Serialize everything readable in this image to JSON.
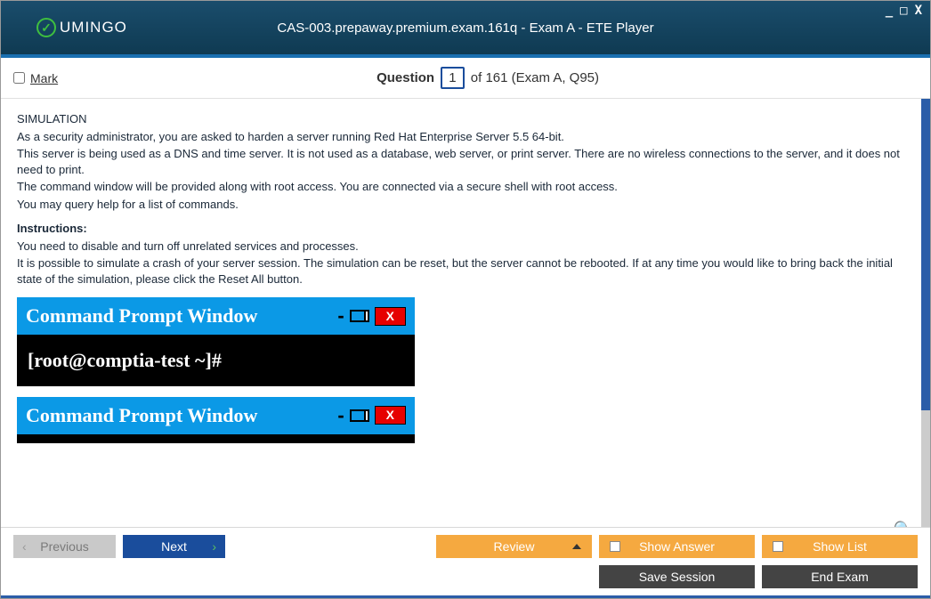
{
  "titlebar": {
    "logo_text": "UMINGO",
    "title": "CAS-003.prepaway.premium.exam.161q - Exam A - ETE Player"
  },
  "header": {
    "mark_label": "Mark",
    "question_label": "Question",
    "question_number": "1",
    "question_total": "of 161 (Exam A, Q95)"
  },
  "content": {
    "sim_label": "SIMULATION",
    "para1_l1": "As a security administrator, you are asked to harden a server running Red Hat Enterprise Server 5.5 64-bit.",
    "para1_l2": "This server is being used as a DNS and time server. It is not used as a database, web server, or print server. There are no wireless connections to the server, and it does not need to print.",
    "para1_l3": "The command window will be provided along with root access. You are connected via a secure shell with root access.",
    "para1_l4": "You may query help for a list of commands.",
    "instr_label": "Instructions:",
    "para2_l1": "You need to disable and turn off unrelated services and processes.",
    "para2_l2": "It is possible to simulate a crash of your server session. The simulation can be reset, but the server cannot be rebooted. If at any time you would like to bring back the initial state of the simulation, please click the Reset All button.",
    "cmd_title": "Command Prompt Window",
    "cmd_close": "X",
    "cmd_prompt": "[root@comptia-test ~]#"
  },
  "buttons": {
    "previous": "Previous",
    "next": "Next",
    "review": "Review",
    "show_answer": "Show Answer",
    "show_list": "Show List",
    "save_session": "Save Session",
    "end_exam": "End Exam"
  }
}
